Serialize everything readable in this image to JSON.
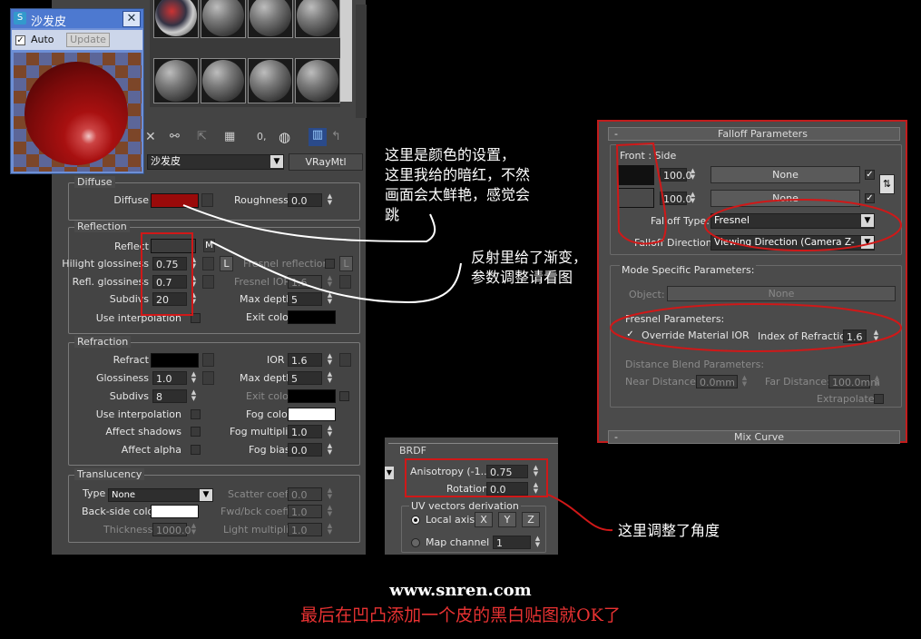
{
  "preview_window": {
    "title": "沙发皮",
    "auto_label": "Auto",
    "update_label": "Update"
  },
  "toolbar": {
    "material_name": "沙发皮",
    "material_type": "VRayMtl"
  },
  "diffuse": {
    "group": "Diffuse",
    "diffuse_label": "Diffuse",
    "diffuse_color": "#9a0a0a",
    "roughness_label": "Roughness",
    "roughness": "0.0"
  },
  "reflection": {
    "group": "Reflection",
    "reflect_label": "Reflect",
    "m_label": "M",
    "hilight_label": "Hilight glossiness",
    "hilight": "0.75",
    "l_label": "L",
    "fresnel_label": "Fresnel reflections",
    "refl_gloss_label": "Refl. glossiness",
    "refl_gloss": "0.7",
    "fresnel_ior_label": "Fresnel IOR",
    "fresnel_ior": "1.6",
    "subdivs_label": "Subdivs",
    "subdivs": "20",
    "max_depth_label": "Max depth",
    "max_depth": "5",
    "use_interp_label": "Use interpolation",
    "exit_color_label": "Exit color"
  },
  "refraction": {
    "group": "Refraction",
    "refract_label": "Refract",
    "ior_label": "IOR",
    "ior": "1.6",
    "glossiness_label": "Glossiness",
    "glossiness": "1.0",
    "max_depth_label": "Max depth",
    "max_depth": "5",
    "subdivs_label": "Subdivs",
    "subdivs": "8",
    "exit_color_label": "Exit color",
    "use_interp_label": "Use interpolation",
    "fog_color_label": "Fog color",
    "affect_shadows_label": "Affect shadows",
    "fog_mult_label": "Fog multiplier",
    "fog_mult": "1.0",
    "affect_alpha_label": "Affect alpha",
    "fog_bias_label": "Fog bias",
    "fog_bias": "0.0"
  },
  "translucency": {
    "group": "Translucency",
    "type_label": "Type",
    "type_value": "None",
    "scatter_label": "Scatter coeff",
    "scatter": "0.0",
    "backside_label": "Back-side color",
    "fwd_label": "Fwd/bck coeff",
    "fwd": "1.0",
    "thickness_label": "Thickness",
    "thickness": "1000.0",
    "light_mult_label": "Light multiplier",
    "light_mult": "1.0"
  },
  "falloff": {
    "title": "Falloff Parameters",
    "front_side_label": "Front : Side",
    "val1": "100.0",
    "val2": "100.0",
    "none1": "None",
    "none2": "None",
    "type_label": "Falloff Type:",
    "type_value": "Fresnel",
    "direction_label": "Falloff Direction:",
    "direction_value": "Viewing Direction (Camera Z-Axis)",
    "mode_label": "Mode Specific Parameters:",
    "object_label": "Object:",
    "object_value": "None",
    "fresnel_params_label": "Fresnel Parameters:",
    "override_label": "Override Material IOR",
    "ior_label": "Index of Refraction",
    "ior_value": "1.6",
    "dist_blend_label": "Distance Blend Parameters:",
    "near_label": "Near Distance:",
    "near_value": "0.0mm",
    "far_label": "Far Distance:",
    "far_value": "100.0mm",
    "extrapolate_label": "Extrapolate",
    "mix_curve": "Mix Curve",
    "minus": "-"
  },
  "brdf": {
    "title": "BRDF",
    "aniso_label": "Anisotropy (-1..1)",
    "aniso": "0.75",
    "rotation_label": "Rotation",
    "rotation": "0.0",
    "uv_label": "UV vectors derivation",
    "local_axis_label": "Local axis",
    "x": "X",
    "y": "Y",
    "z": "Z",
    "map_channel_label": "Map channel",
    "map_channel": "1"
  },
  "notes": {
    "diffuse_note_1": "这里是颜色的设置，",
    "diffuse_note_2": "这里我给的暗红，不然",
    "diffuse_note_3": "画面会太鲜艳，感觉会",
    "diffuse_note_4": "跳",
    "reflect_note_1": "反射里给了渐变，",
    "reflect_note_2": "参数调整请看图",
    "brdf_note": "这里调整了角度",
    "site": "www.snren.com",
    "final": "最后在凹凸添加一个皮的黑白贴图就OK了"
  },
  "colors": {
    "annotation_red": "#d01818",
    "final_text_red": "#e83232"
  }
}
